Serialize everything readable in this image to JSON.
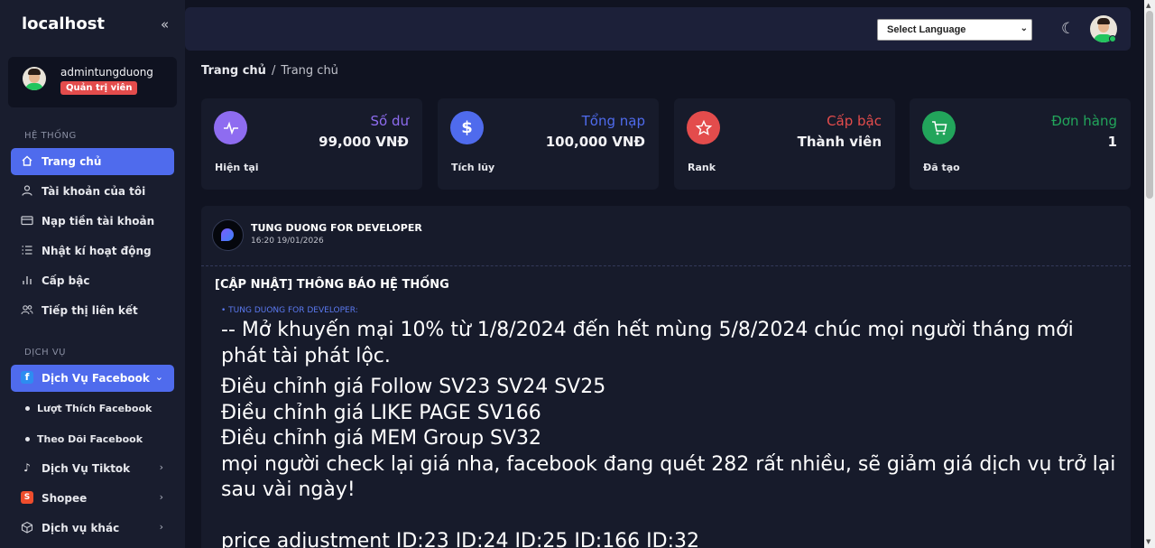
{
  "sidebar": {
    "brand": "localhost",
    "user": {
      "name": "admintungduong",
      "role": "Quản trị viên"
    },
    "sections": {
      "system": "HỆ THỐNG",
      "services": "DỊCH VỤ"
    },
    "items": [
      {
        "label": "Trang chủ",
        "icon": "home-icon"
      },
      {
        "label": "Tài khoản của tôi",
        "icon": "user-icon"
      },
      {
        "label": "Nạp tiền tài khoản",
        "icon": "card-icon"
      },
      {
        "label": "Nhật kí hoạt động",
        "icon": "list-icon"
      },
      {
        "label": "Cấp bậc",
        "icon": "bar-chart-icon"
      },
      {
        "label": "Tiếp thị liên kết",
        "icon": "users-icon"
      }
    ],
    "services": [
      {
        "label": "Dịch Vụ Facebook",
        "icon": "facebook-icon"
      },
      {
        "label": "Dịch Vụ Tiktok",
        "icon": "tiktok-icon"
      },
      {
        "label": "Shopee",
        "icon": "shopee-icon"
      },
      {
        "label": "Dịch vụ khác",
        "icon": "cube-icon"
      }
    ],
    "sub_items": [
      "Lượt Thích Facebook",
      "Theo Dõi Facebook"
    ]
  },
  "topbar": {
    "language_select": "Select Language"
  },
  "breadcrumb": {
    "root": "Trang chủ",
    "current": "Trang chủ"
  },
  "cards": [
    {
      "title": "Số dư",
      "value": "99,000 VNĐ",
      "foot": "Hiện tại",
      "color": "#8e6cf0",
      "icon": "activity-icon"
    },
    {
      "title": "Tổng nạp",
      "value": "100,000 VNĐ",
      "foot": "Tích lũy",
      "color": "#4f6bed",
      "icon": "dollar-icon"
    },
    {
      "title": "Cấp bậc",
      "value": "Thành viên",
      "foot": "Rank",
      "color": "#e34c4c",
      "icon": "star-icon"
    },
    {
      "title": "Đơn hàng",
      "value": "1",
      "foot": "Đã tạo",
      "color": "#22a55b",
      "icon": "cart-icon"
    }
  ],
  "post": {
    "author": "TUNG DUONG FOR DEVELOPER",
    "date": "16:20 19/01/2026",
    "title": "[CẬP NHẬT] THÔNG BÁO HỆ THỐNG",
    "tag": "• TUNG DUONG FOR DEVELOPER:",
    "lines": [
      "-- Mở khuyến mại 10% từ 1/8/2024 đến hết mùng 5/8/2024 chúc mọi người tháng mới phát tài phát lộc.",
      "Điều chỉnh giá Follow SV23 SV24 SV25",
      "Điều chỉnh giá LIKE PAGE SV166",
      "Điều chỉnh giá MEM Group SV32",
      "mọi người check lại giá nha, facebook đang quét 282 rất nhiều, sẽ giảm giá dịch vụ trở lại sau vài ngày!",
      "price adjustment ID:23 ID:24 ID:25 ID:166 ID:32"
    ]
  }
}
